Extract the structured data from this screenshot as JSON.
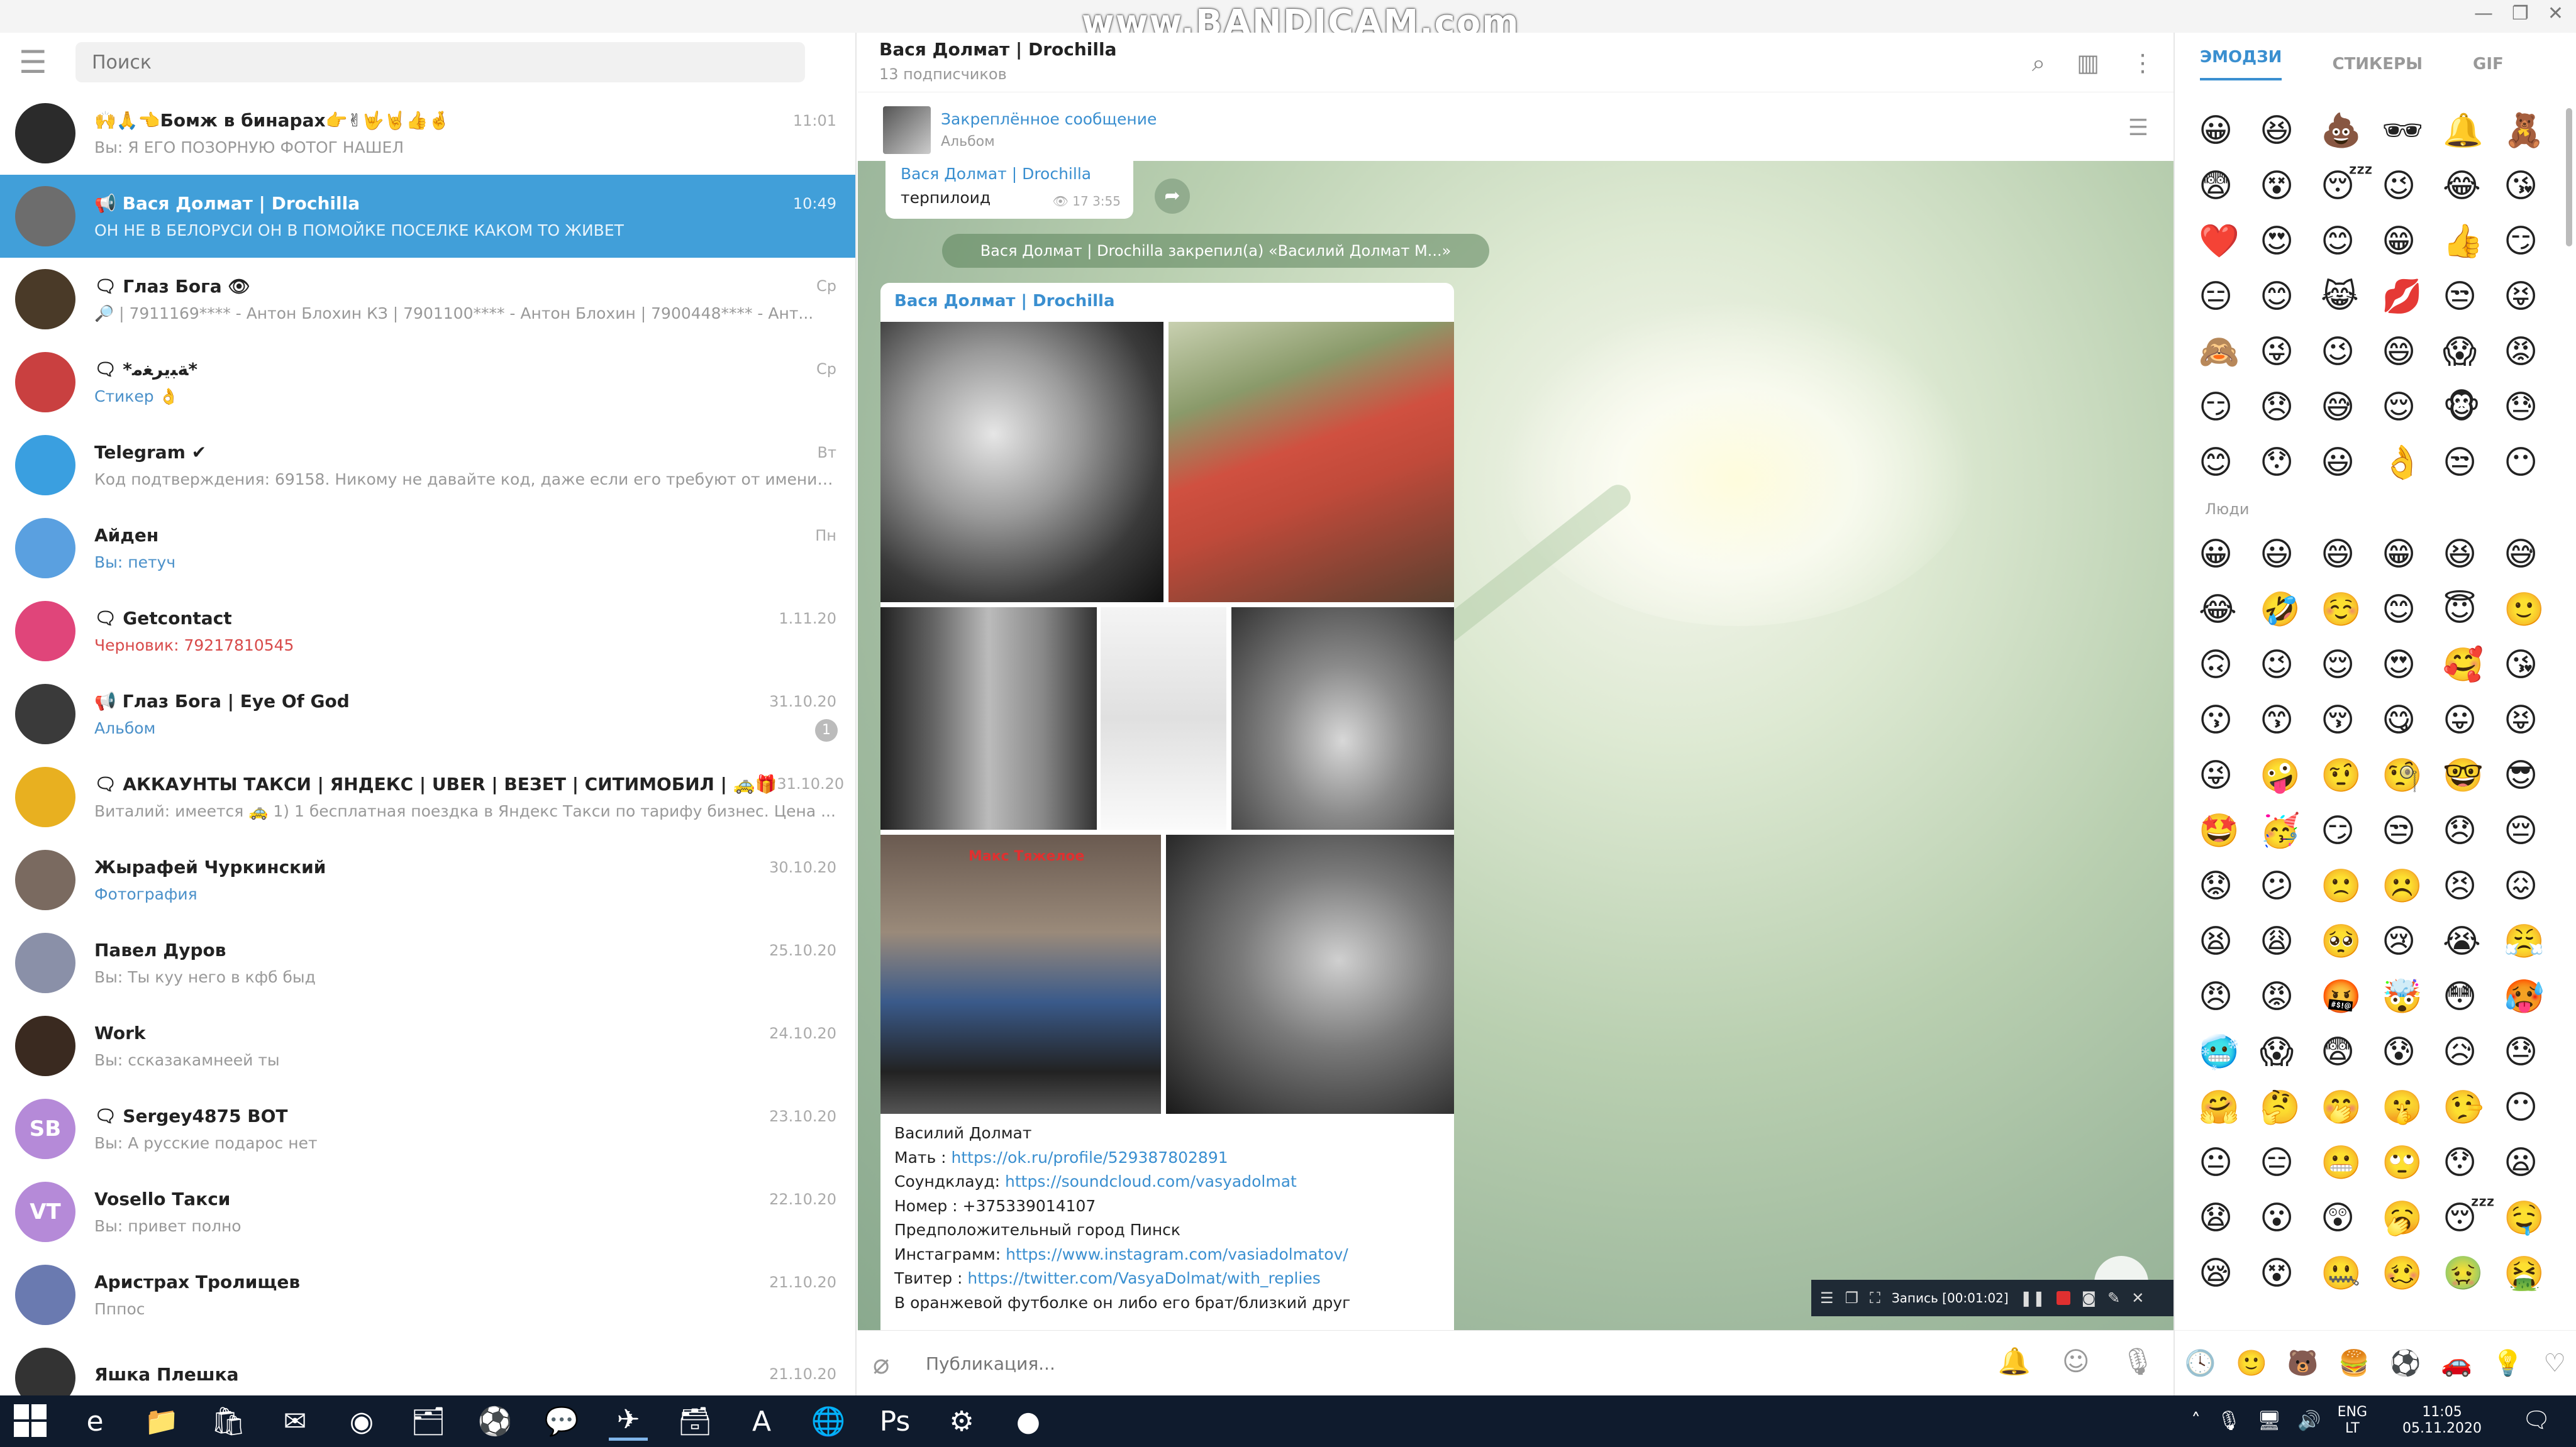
{
  "watermark": "www.BANDICAM.com",
  "left": {
    "search_placeholder": "Поиск",
    "chats": [
      {
        "name": "🙌🙏👈Бомж в бинарах👉✌🤟🤘👍🤞",
        "time": "11:01",
        "preview": "Вы: Я ЕГО ПОЗОРНУЮ ФОТОГ НАШЕЛ",
        "avatar": "#2b2b2b",
        "kind": "channel"
      },
      {
        "name": "📢 Вася Долмат | Drochilla",
        "time": "10:49",
        "preview": "ОН НЕ В БЕЛОРУСИ ОН В ПОМОЙКЕ ПОСЕЛКЕ КАКОМ ТО ЖИВЕТ",
        "avatar": "#6d6d6d",
        "kind": "active"
      },
      {
        "name": "🗨 Глаз Бога 👁",
        "time": "Ср",
        "preview": "🔎 | 7911169**** - Антон Блохин КЗ | 7901100**** - Антон Блохин | 7900448**** - Ант...",
        "avatar": "#4a3a28",
        "kind": "group"
      },
      {
        "name": "🗨 *ﺔﺒﻳﺮﻐﻣ*",
        "time": "Ср",
        "preview": "Стикер 👌",
        "avatar": "#c94040",
        "kind": "link"
      },
      {
        "name": "Telegram ✔",
        "time": "Вт",
        "preview": "Код подтверждения: 69158. Никому не давайте код, даже если его требуют от имени Те...",
        "avatar": "#3a9fe0",
        "kind": "plain"
      },
      {
        "name": "Айден",
        "time": "Пн",
        "preview": "Вы: петуч",
        "avatar": "#5aa0e0",
        "kind": "link"
      },
      {
        "name": "🗨 Getcontact",
        "time": "1.11.20",
        "preview": "Черновик: 79217810545",
        "avatar": "#e0457a",
        "kind": "draft"
      },
      {
        "name": "📢 Глаз Бога | Eye Of God",
        "time": "31.10.20",
        "preview": "Альбом",
        "avatar": "#3a3a3a",
        "kind": "link",
        "badge": "1"
      },
      {
        "name": "🗨 АККАУНТЫ ТАКСИ | ЯНДЕКС | UBER | ВЕЗЕТ | СИТИМОБИЛ | 🚕🎁",
        "time": "31.10.20",
        "preview": "Виталий: имеется 🚕 1) 1 бесплатная поездка в Яндекс Такси по тарифу бизнес. Цена ...",
        "avatar": "#e8b020",
        "kind": "plain"
      },
      {
        "name": "Жырафей Чуркинский",
        "time": "30.10.20",
        "preview": "Фотография",
        "avatar": "#7a6a60",
        "kind": "link"
      },
      {
        "name": "Павел Дуров",
        "time": "25.10.20",
        "preview": "Вы: Ты куу него в кфб быд",
        "avatar": "#8a90a8",
        "kind": "plain"
      },
      {
        "name": "Work",
        "time": "24.10.20",
        "preview": "Вы: ссказакамнеей ты",
        "avatar": "#3a2a20",
        "kind": "plain"
      },
      {
        "name": "🗨 Sergey4875 BOT",
        "time": "23.10.20",
        "preview": "Вы: А русские подарос нет",
        "avatar": "#b58ad8",
        "initials": "SB",
        "kind": "plain"
      },
      {
        "name": "Vosello Такси",
        "time": "22.10.20",
        "preview": "Вы: привет полно",
        "avatar": "#b58ad8",
        "initials": "VT",
        "kind": "plain"
      },
      {
        "name": "Аристрах Тролищев",
        "time": "21.10.20",
        "preview": "Пппос",
        "avatar": "#6a7ab0",
        "kind": "plain"
      },
      {
        "name": "Яшка Плешка",
        "time": "21.10.20",
        "preview": "",
        "avatar": "#333333",
        "kind": "plain"
      }
    ]
  },
  "chat": {
    "title": "Вася Долмат | Drochilla",
    "subtitle": "13 подписчиков",
    "pinned_title": "Закреплённое сообщение",
    "pinned_sub": "Альбом",
    "msg_author": "Вася Долмат | Drochilla",
    "msg_text": "терпилоид",
    "msg_views": "👁 17  3:55",
    "service": "Вася Долмат | Drochilla закрепил(а) «Василий Долмат М...»",
    "post_author": "Вася Долмат | Drochilla",
    "photo_caption": "Макс Тяжелое",
    "post_lines": [
      {
        "label": "Василий Долмат",
        "link": ""
      },
      {
        "label": "Мать : ",
        "link": "https://ok.ru/profile/529387802891"
      },
      {
        "label": "Соундклауд: ",
        "link": "https://soundcloud.com/vasyadolmat"
      },
      {
        "label": "Номер : +375339014107",
        "link": ""
      },
      {
        "label": "Предположительный город Пинск",
        "link": ""
      },
      {
        "label": "Инстаграмм: ",
        "link": "https://www.instagram.com/vasiadolmatov/"
      },
      {
        "label": "Твитер : ",
        "link": "https://twitter.com/VasyaDolmat/with_replies"
      },
      {
        "label": "В оранжевой футболке он либо его брат/близкий друг",
        "link": ""
      }
    ],
    "input_placeholder": "Публикация...",
    "recorder_text": "Запись [00:01:02]"
  },
  "emoji": {
    "tabs": [
      "ЭМОДЗИ",
      "СТИКЕРЫ",
      "GIF"
    ],
    "recent": [
      "😀",
      "😆",
      "💩",
      "🕶",
      "🔔",
      "🧸",
      "😨",
      "😵",
      "😴",
      "😉",
      "😂",
      "😘",
      "❤️",
      "😍",
      "😊",
      "😁",
      "👍",
      "😏",
      "😑",
      "😊",
      "😹",
      "💋",
      "😒",
      "😝",
      "🙈",
      "😜",
      "😉",
      "😄",
      "😱",
      "😡",
      "😏",
      "😞",
      "😅",
      "😌",
      "🐵",
      "😓",
      "😊",
      "😯",
      "😃",
      "👌",
      "😒",
      "😶"
    ],
    "section": "Люди",
    "people": [
      "😀",
      "😃",
      "😄",
      "😁",
      "😆",
      "😅",
      "😂",
      "🤣",
      "☺️",
      "😊",
      "😇",
      "🙂",
      "🙃",
      "😉",
      "😌",
      "😍",
      "🥰",
      "😘",
      "😗",
      "😙",
      "😚",
      "😋",
      "😛",
      "😝",
      "😜",
      "🤪",
      "🤨",
      "🧐",
      "🤓",
      "😎",
      "🤩",
      "🥳",
      "😏",
      "😒",
      "😞",
      "😔",
      "😟",
      "😕",
      "🙁",
      "☹️",
      "😣",
      "😖",
      "😫",
      "😩",
      "🥺",
      "😢",
      "😭",
      "😤",
      "😠",
      "😡",
      "🤬",
      "🤯",
      "😳",
      "🥵",
      "🥶",
      "😱",
      "😨",
      "😰",
      "😥",
      "😓",
      "🤗",
      "🤔",
      "🤭",
      "🤫",
      "🤥",
      "😶",
      "😐",
      "😑",
      "😬",
      "🙄",
      "😯",
      "😦",
      "😧",
      "😮",
      "😲",
      "🥱",
      "😴",
      "🤤",
      "😪",
      "😵",
      "🤐",
      "🥴",
      "🤢",
      "🤮"
    ],
    "cats": [
      "🕓",
      "🙂",
      "🐻",
      "🍔",
      "⚽",
      "🚗",
      "💡",
      "♡"
    ]
  },
  "taskbar": {
    "apps": [
      "e",
      "📁",
      "🛍",
      "✉",
      "◉",
      "🗂",
      "⚽",
      "💬",
      "✈",
      "🗃",
      "A",
      "🌐",
      "Ps",
      "⚙",
      "●"
    ],
    "lang_top": "ENG",
    "lang_bottom": "LT",
    "time": "11:05",
    "date": "05.11.2020"
  }
}
